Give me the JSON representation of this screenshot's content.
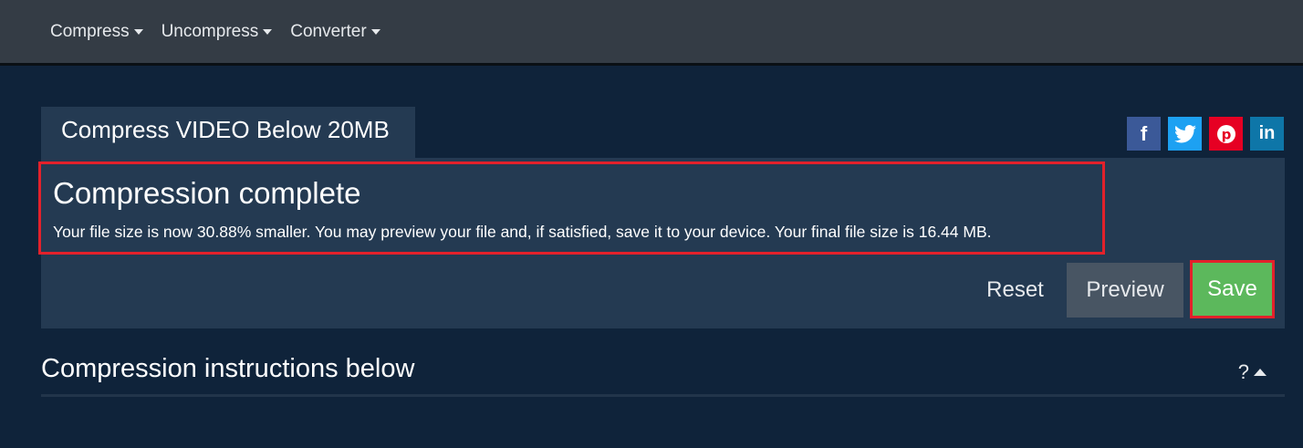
{
  "nav": {
    "items": [
      {
        "label": "Compress"
      },
      {
        "label": "Uncompress"
      },
      {
        "label": "Converter"
      }
    ]
  },
  "tab": {
    "title": "Compress VIDEO Below 20MB"
  },
  "social": {
    "facebook": {
      "glyph": "f",
      "color": "#3b5998"
    },
    "twitter": {
      "glyph": "t",
      "color": "#1da1f2"
    },
    "pinterest": {
      "glyph": "p",
      "color": "#e60023"
    },
    "linkedin": {
      "glyph": "in",
      "color": "#0e76a8"
    }
  },
  "result": {
    "heading": "Compression complete",
    "message": "Your file size is now 30.88% smaller. You may preview your file and, if satisfied, save it to your device. Your final file size is  16.44 MB."
  },
  "actions": {
    "reset_label": "Reset",
    "preview_label": "Preview",
    "save_label": "Save"
  },
  "instructions": {
    "heading": "Compression instructions below",
    "toggle_label": "?"
  },
  "colors": {
    "background": "#0f233a",
    "panel": "#243a52",
    "navbar": "#343c45",
    "save": "#5cb85c",
    "highlight": "#e3212b"
  }
}
